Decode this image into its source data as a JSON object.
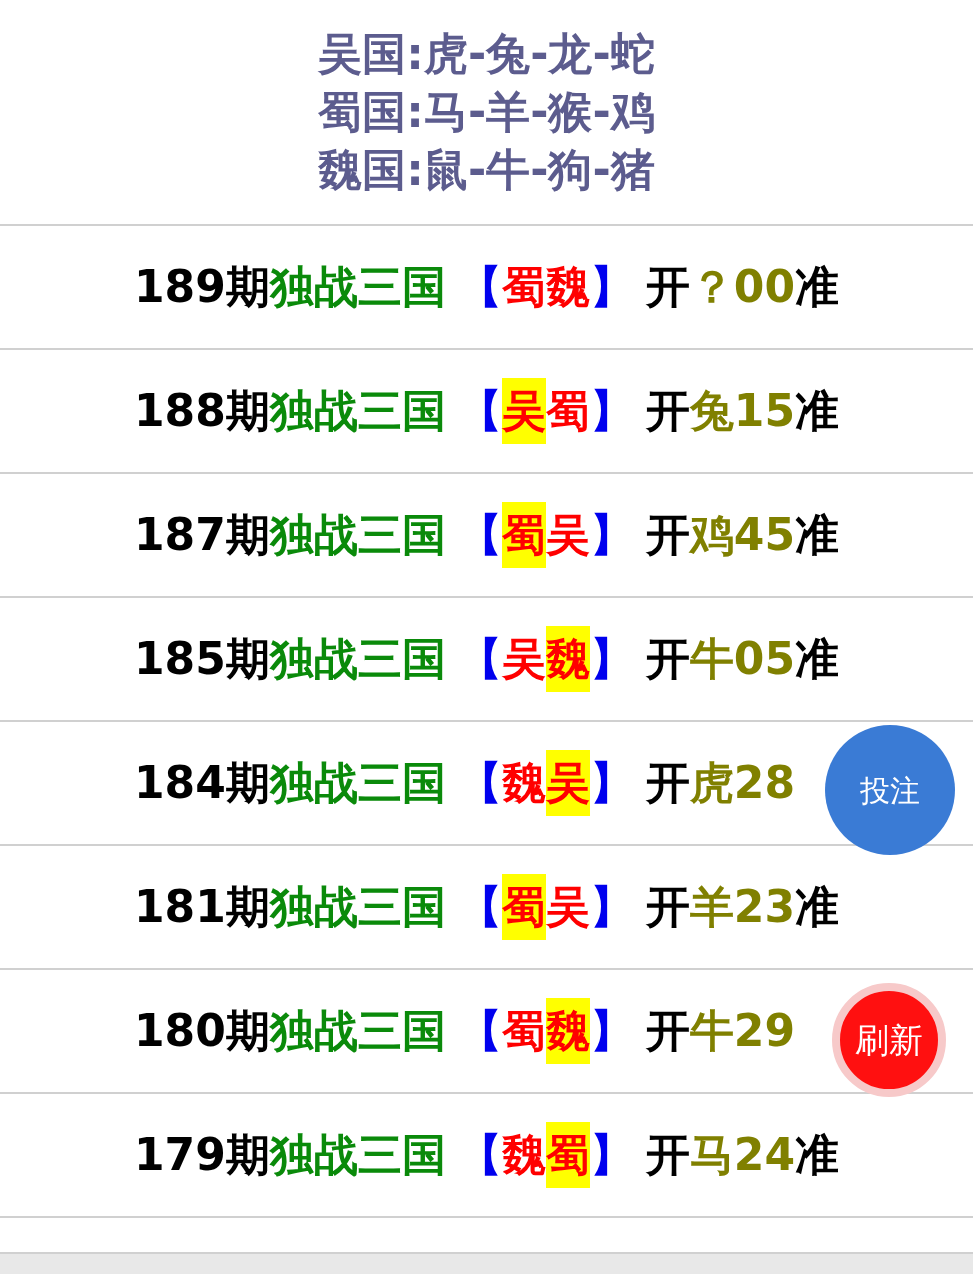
{
  "zodiac_groups": [
    "吴国:虎-兔-龙-蛇",
    "蜀国:马-羊-猴-鸡",
    "魏国:鼠-牛-狗-猪"
  ],
  "rows": [
    {
      "issue": "189期",
      "title": "独战三国",
      "open": "【",
      "picks": [
        {
          "text": "蜀",
          "hit": false
        },
        {
          "text": "魏",
          "hit": false
        }
      ],
      "close": "】",
      "prefix": "开",
      "result": "？00",
      "suffix": "准"
    },
    {
      "issue": "188期",
      "title": "独战三国",
      "open": "【",
      "picks": [
        {
          "text": "吴",
          "hit": true
        },
        {
          "text": "蜀",
          "hit": false
        }
      ],
      "close": "】",
      "prefix": "开",
      "result": "兔15",
      "suffix": "准"
    },
    {
      "issue": "187期",
      "title": "独战三国",
      "open": "【",
      "picks": [
        {
          "text": "蜀",
          "hit": true
        },
        {
          "text": "吴",
          "hit": false
        }
      ],
      "close": "】",
      "prefix": "开",
      "result": "鸡45",
      "suffix": "准"
    },
    {
      "issue": "185期",
      "title": "独战三国",
      "open": "【",
      "picks": [
        {
          "text": "吴",
          "hit": false
        },
        {
          "text": "魏",
          "hit": true
        }
      ],
      "close": "】",
      "prefix": "开",
      "result": "牛05",
      "suffix": "准"
    },
    {
      "issue": "184期",
      "title": "独战三国",
      "open": "【",
      "picks": [
        {
          "text": "魏",
          "hit": false
        },
        {
          "text": "吴",
          "hit": true
        }
      ],
      "close": "】",
      "prefix": "开",
      "result": "虎28"
    },
    {
      "issue": "181期",
      "title": "独战三国",
      "open": "【",
      "picks": [
        {
          "text": "蜀",
          "hit": true
        },
        {
          "text": "吴",
          "hit": false
        }
      ],
      "close": "】",
      "prefix": "开",
      "result": "羊23",
      "suffix": "准"
    },
    {
      "issue": "180期",
      "title": "独战三国",
      "open": "【",
      "picks": [
        {
          "text": "蜀",
          "hit": false
        },
        {
          "text": "魏",
          "hit": true
        }
      ],
      "close": "】",
      "prefix": "开",
      "result": "牛29"
    },
    {
      "issue": "179期",
      "title": "独战三国",
      "open": "【",
      "picks": [
        {
          "text": "魏",
          "hit": false
        },
        {
          "text": "蜀",
          "hit": true
        }
      ],
      "close": "】",
      "prefix": "开",
      "result": "马24",
      "suffix": "准"
    }
  ],
  "bet_button": "投注",
  "refresh_button": "刷新"
}
